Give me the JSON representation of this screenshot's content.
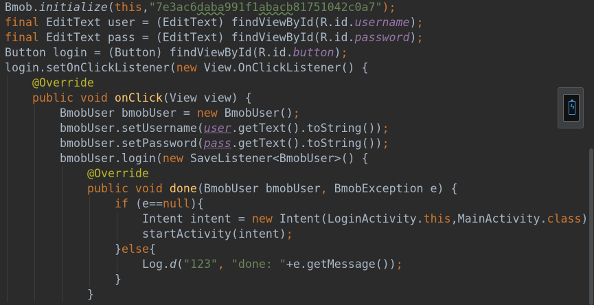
{
  "editor": {
    "fold_marker": "^",
    "lines": [
      {
        "name": "line-1",
        "segments": [
          {
            "t": "Bmob."
          },
          {
            "t": "initialize",
            "c": "sm"
          },
          {
            "t": "("
          },
          {
            "t": "this",
            "c": "kw"
          },
          {
            "t": ","
          },
          {
            "t": "\"7e3ac6",
            "c": "str"
          },
          {
            "t": "daba",
            "c": "str squig"
          },
          {
            "t": "991f1",
            "c": "str"
          },
          {
            "t": "abacb",
            "c": "str squig"
          },
          {
            "t": "81751042c0a7\"",
            "c": "str"
          },
          {
            "t": ");",
            "c": "kw"
          }
        ]
      },
      {
        "name": "line-2",
        "segments": [
          {
            "t": "final ",
            "c": "kw"
          },
          {
            "t": "EditText user = (EditText) findViewById(R.id."
          },
          {
            "t": "username",
            "c": "fld"
          },
          {
            "t": ")"
          },
          {
            "t": ";",
            "c": "kw"
          }
        ]
      },
      {
        "name": "line-3",
        "segments": [
          {
            "t": "final ",
            "c": "kw"
          },
          {
            "t": "EditText pass = (EditText) findViewById(R.id."
          },
          {
            "t": "password",
            "c": "fld"
          },
          {
            "t": ")"
          },
          {
            "t": ";",
            "c": "kw"
          }
        ]
      },
      {
        "name": "line-4",
        "segments": [
          {
            "t": "Button login = (Button) findViewById(R.id."
          },
          {
            "t": "button",
            "c": "fld"
          },
          {
            "t": ")"
          },
          {
            "t": ";",
            "c": "kw"
          }
        ]
      },
      {
        "name": "line-5",
        "segments": [
          {
            "t": "login.setOnClickListener("
          },
          {
            "t": "new ",
            "c": "kw"
          },
          {
            "t": "View.OnClickListener() {"
          }
        ]
      },
      {
        "name": "line-6",
        "indent": 1,
        "segments": [
          {
            "t": "@Override",
            "c": "ann"
          }
        ]
      },
      {
        "name": "line-7",
        "indent": 1,
        "segments": [
          {
            "t": "public void ",
            "c": "kw"
          },
          {
            "t": "onClick",
            "c": "fn"
          },
          {
            "t": "(View view) {"
          }
        ]
      },
      {
        "name": "line-8",
        "indent": 2,
        "segments": [
          {
            "t": "BmobUser bmobUser = "
          },
          {
            "t": "new ",
            "c": "kw"
          },
          {
            "t": "BmobUser()"
          },
          {
            "t": ";",
            "c": "kw"
          }
        ]
      },
      {
        "name": "line-9",
        "indent": 2,
        "segments": [
          {
            "t": "bmobUser.setUsername("
          },
          {
            "t": "user",
            "c": "fld ul"
          },
          {
            "t": ".getText().toString())"
          },
          {
            "t": ";",
            "c": "kw"
          }
        ]
      },
      {
        "name": "line-10",
        "indent": 2,
        "segments": [
          {
            "t": "bmobUser.setPassword("
          },
          {
            "t": "pass",
            "c": "fld ul"
          },
          {
            "t": ".getText().toString())"
          },
          {
            "t": ";",
            "c": "kw"
          }
        ]
      },
      {
        "name": "line-11",
        "indent": 2,
        "segments": [
          {
            "t": "bmobUser.login("
          },
          {
            "t": "new ",
            "c": "kw"
          },
          {
            "t": "SaveListener<BmobUser>() {"
          }
        ]
      },
      {
        "name": "line-12",
        "indent": 3,
        "segments": [
          {
            "t": "@Override",
            "c": "ann"
          }
        ]
      },
      {
        "name": "line-13",
        "indent": 3,
        "segments": [
          {
            "t": "public void ",
            "c": "kw"
          },
          {
            "t": "done",
            "c": "fn"
          },
          {
            "t": "(BmobUser bmobUser"
          },
          {
            "t": ", ",
            "c": "kw"
          },
          {
            "t": "BmobException e) {"
          }
        ]
      },
      {
        "name": "line-14",
        "indent": 4,
        "segments": [
          {
            "t": "if ",
            "c": "kw"
          },
          {
            "t": "(e=="
          },
          {
            "t": "null",
            "c": "kw"
          },
          {
            "t": "){"
          }
        ]
      },
      {
        "name": "line-15",
        "indent": 5,
        "segments": [
          {
            "t": "Intent intent = "
          },
          {
            "t": "new ",
            "c": "kw"
          },
          {
            "t": "Intent(LoginActivity."
          },
          {
            "t": "this",
            "c": "kw"
          },
          {
            "t": ","
          },
          {
            "t": "MainActivity."
          },
          {
            "t": "class",
            "c": "kw"
          },
          {
            "t": ")"
          },
          {
            "t": ";",
            "c": "kw"
          }
        ]
      },
      {
        "name": "line-16",
        "indent": 5,
        "segments": [
          {
            "t": "startActivity(intent)"
          },
          {
            "t": ";",
            "c": "kw"
          }
        ]
      },
      {
        "name": "line-17",
        "indent": 4,
        "segments": [
          {
            "t": "}"
          },
          {
            "t": "else",
            "c": "kw"
          },
          {
            "t": "{"
          }
        ]
      },
      {
        "name": "line-18",
        "indent": 5,
        "segments": [
          {
            "t": "Log."
          },
          {
            "t": "d",
            "c": "sm"
          },
          {
            "t": "("
          },
          {
            "t": "\"123\"",
            "c": "str"
          },
          {
            "t": ", ",
            "c": "kw"
          },
          {
            "t": "\"done: \"",
            "c": "str"
          },
          {
            "t": "+e.getMessage())"
          },
          {
            "t": ";",
            "c": "kw"
          }
        ]
      },
      {
        "name": "line-19",
        "indent": 4,
        "segments": [
          {
            "t": "}"
          }
        ]
      },
      {
        "name": "line-20",
        "indent": 3,
        "segments": [
          {
            "t": "}"
          }
        ]
      }
    ]
  },
  "colors": {
    "background": "#2b2b2b",
    "default_text": "#a9b7c6",
    "keyword": "#cc7832",
    "string": "#6a8759",
    "annotation": "#bbb529",
    "field": "#9876aa",
    "method_decl": "#ffc66d"
  },
  "icons": {
    "device": "phone-battery-icon"
  }
}
